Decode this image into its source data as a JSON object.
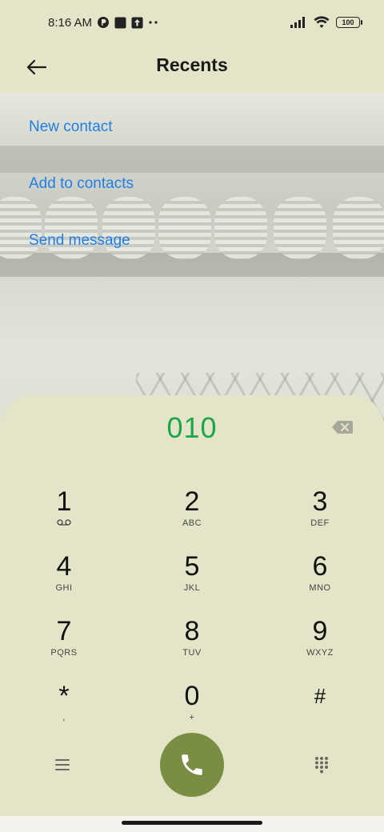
{
  "status_bar": {
    "time": "8:16 AM",
    "battery": "100",
    "left_icons": [
      "notification-p-icon",
      "square-icon",
      "upload-icon",
      "more-dots-icon"
    ],
    "right_icons": [
      "signal-icon",
      "wifi-icon",
      "battery-icon"
    ]
  },
  "header": {
    "title": "Recents",
    "back_icon": "arrow-left-icon"
  },
  "actions": [
    {
      "label": "New contact"
    },
    {
      "label": "Add to contacts"
    },
    {
      "label": "Send message"
    }
  ],
  "dialpad": {
    "number": "010",
    "keys": [
      {
        "digit": "1",
        "letters": ""
      },
      {
        "digit": "2",
        "letters": "ABC"
      },
      {
        "digit": "3",
        "letters": "DEF"
      },
      {
        "digit": "4",
        "letters": "GHI"
      },
      {
        "digit": "5",
        "letters": "JKL"
      },
      {
        "digit": "6",
        "letters": "MNO"
      },
      {
        "digit": "7",
        "letters": "PQRS"
      },
      {
        "digit": "8",
        "letters": "TUV"
      },
      {
        "digit": "9",
        "letters": "WXYZ"
      },
      {
        "digit": "*",
        "letters": ","
      },
      {
        "digit": "0",
        "letters": "+"
      },
      {
        "digit": "#",
        "letters": ""
      }
    ]
  },
  "colors": {
    "background": "#e4e4c8",
    "link": "#1f7fe8",
    "dialed_number": "#1aa64a",
    "call_button": "#7a8e43"
  }
}
